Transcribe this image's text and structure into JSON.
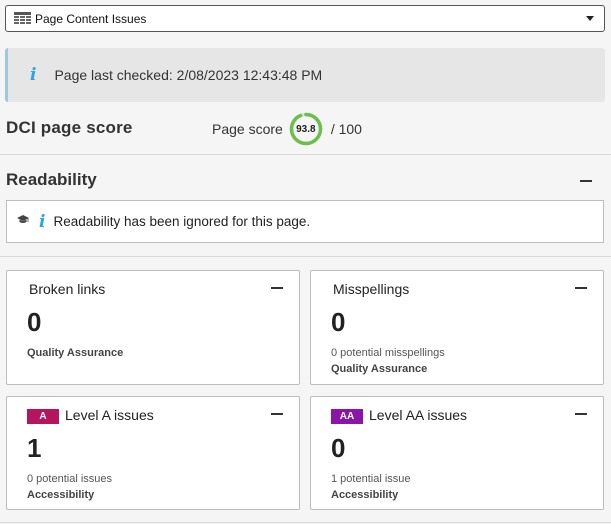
{
  "dropdown": {
    "icon": "table-icon",
    "label": "Page Content Issues"
  },
  "banner": {
    "icon": "info-icon",
    "text": "Page last checked: 2/08/2023 12:43:48 PM"
  },
  "score": {
    "title": "DCI page score",
    "label": "Page score",
    "value": "93.8",
    "value_fraction": 0.938,
    "max": "/ 100",
    "ring_color": "#6cc04a"
  },
  "readability": {
    "title": "Readability",
    "message": "Readability has been ignored for this page.",
    "icons": [
      "graduation-cap-icon",
      "info-icon"
    ]
  },
  "cards": {
    "broken_links": {
      "title": "Broken links",
      "count": "0",
      "category": "Quality Assurance"
    },
    "misspellings": {
      "title": "Misspellings",
      "count": "0",
      "sub": "0 potential misspellings",
      "category": "Quality Assurance"
    },
    "level_a": {
      "badge": "A",
      "badge_color": "#b5155d",
      "title": "Level A issues",
      "count": "1",
      "sub": "0 potential issues",
      "category": "Accessibility"
    },
    "level_aa": {
      "badge": "AA",
      "badge_color": "#8a16a8",
      "title": "Level AA issues",
      "count": "0",
      "sub": "1 potential issue",
      "category": "Accessibility"
    }
  },
  "colors": {
    "info": "#2aa4e8",
    "banner_bg": "#e6e6e6",
    "page_bg": "#f5f5f5"
  }
}
